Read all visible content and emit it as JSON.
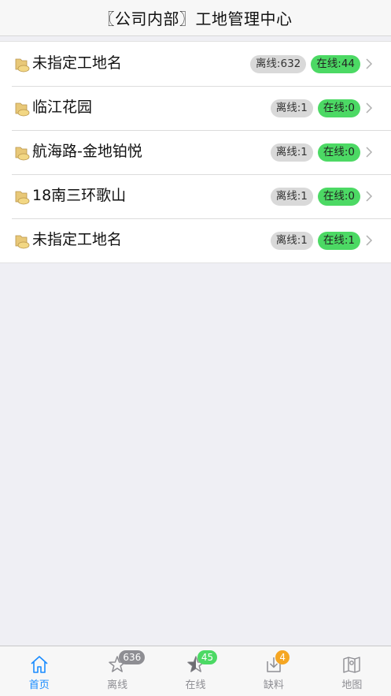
{
  "header": {
    "title": "〖公司内部〗工地管理中心"
  },
  "sites": [
    {
      "name": "未指定工地名",
      "offline": "离线:632",
      "online": "在线:44"
    },
    {
      "name": "临江花园",
      "offline": "离线:1",
      "online": "在线:0"
    },
    {
      "name": "航海路-金地铂悦",
      "offline": "离线:1",
      "online": "在线:0"
    },
    {
      "name": "18南三环歌山",
      "offline": "离线:1",
      "online": "在线:0"
    },
    {
      "name": "未指定工地名",
      "offline": "离线:1",
      "online": "在线:1"
    }
  ],
  "tabs": [
    {
      "label": "首页",
      "icon": "home-icon",
      "badge": null
    },
    {
      "label": "离线",
      "icon": "star-outline-icon",
      "badge": "636"
    },
    {
      "label": "在线",
      "icon": "star-half-icon",
      "badge": "45"
    },
    {
      "label": "缺料",
      "icon": "download-box-icon",
      "badge": "4"
    },
    {
      "label": "地图",
      "icon": "map-icon",
      "badge": null
    }
  ],
  "colors": {
    "accent": "#1a8cff",
    "online_badge": "#4cd964",
    "offline_badge": "#d9d9d9",
    "tab_badge_gray": "#8e8e93",
    "tab_badge_orange": "#f5a623"
  }
}
